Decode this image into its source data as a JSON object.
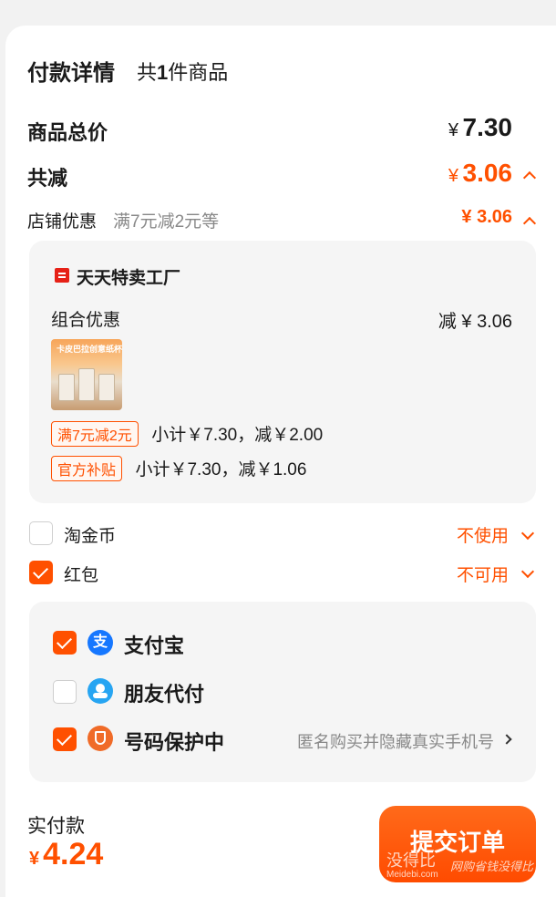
{
  "header": {
    "title": "付款详情",
    "count_prefix": "共",
    "count": "1",
    "count_suffix": "件商品"
  },
  "summary": {
    "total_label": "商品总价",
    "total_yen": "¥",
    "total_value": "7.30",
    "discount_label": "共减",
    "discount_yen": "¥",
    "discount_value": "3.06",
    "shop_promo_label": "店铺优惠",
    "shop_promo_desc": "满7元减2元等",
    "shop_promo_value": "¥ 3.06"
  },
  "shop": {
    "name": "天天特卖工厂",
    "combo_label": "组合优惠",
    "combo_value": "减 ¥ 3.06",
    "product_thumb_text": "卡皮巴拉创意纸杯",
    "promos": [
      {
        "tag": "满7元减2元",
        "text": "小计￥7.30，减￥2.00"
      },
      {
        "tag": "官方补贴",
        "text": "小计￥7.30，减￥1.06"
      }
    ]
  },
  "options": {
    "coins_label": "淘金币",
    "coins_value": "不使用",
    "redpacket_label": "红包",
    "redpacket_value": "不可用"
  },
  "payment": {
    "alipay_label": "支付宝",
    "friend_label": "朋友代付",
    "privacy_label": "号码保护中",
    "privacy_desc": "匿名购买并隐藏真实手机号"
  },
  "footer": {
    "pay_label": "实付款",
    "pay_yen": "¥",
    "pay_value": "4.24",
    "submit_label": "提交订单"
  },
  "watermark": {
    "main": "没得比",
    "sub": "Meidebi.com",
    "slogan": "网购省钱没得比"
  },
  "colors": {
    "accent": "#ff5000",
    "alipay": "#1677ff",
    "friend": "#27a5f2",
    "privacy": "#f06b28"
  }
}
